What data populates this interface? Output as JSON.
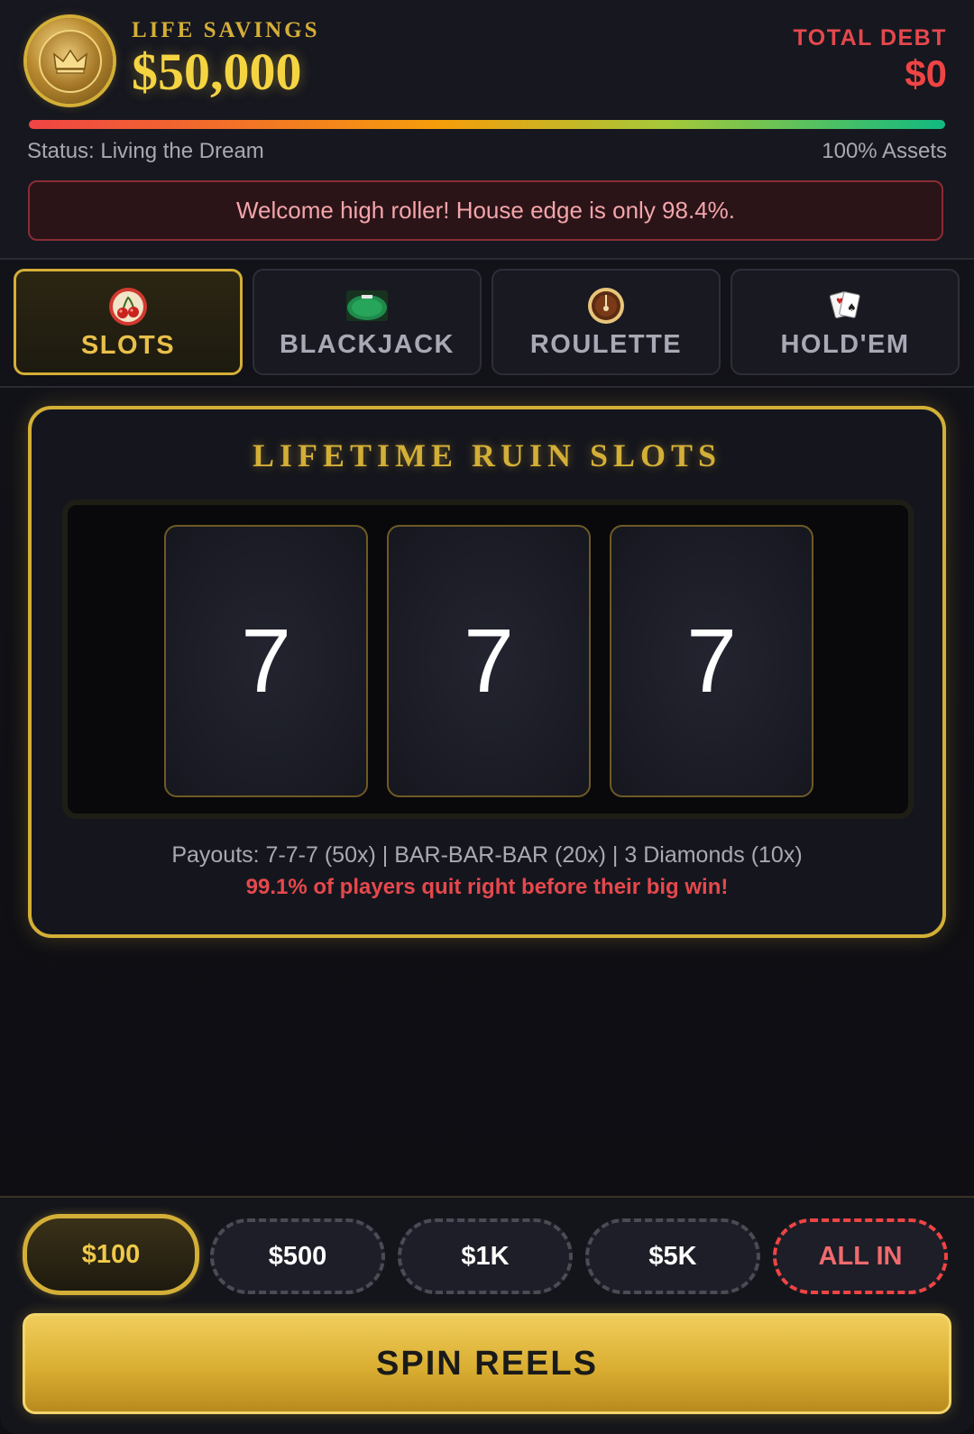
{
  "header": {
    "savings_label": "LIFE SAVINGS",
    "savings_value": "$50,000",
    "debt_label": "TOTAL DEBT",
    "debt_value": "$0",
    "assets_fraction": 1.0,
    "status_text": "Status: Living the Dream",
    "assets_text": "100% Assets",
    "coin_icon": "crown-coin-icon"
  },
  "banner": {
    "message": "Welcome high roller! House edge is only 98.4%."
  },
  "tabs": [
    {
      "label": "SLOTS",
      "icon": "cherry-icon",
      "active": true
    },
    {
      "label": "BLACKJACK",
      "icon": "card-table-icon",
      "active": false
    },
    {
      "label": "ROULETTE",
      "icon": "roulette-wheel-icon",
      "active": false
    },
    {
      "label": "HOLD'EM",
      "icon": "playing-cards-icon",
      "active": false
    }
  ],
  "slots": {
    "title": "LIFETIME RUIN SLOTS",
    "reels": [
      "7",
      "7",
      "7"
    ],
    "payouts": "Payouts: 7-7-7 (50x) | BAR-BAR-BAR (20x) | 3 Diamonds (10x)",
    "warning": "99.1% of players quit right before their big win!"
  },
  "bets": {
    "chips": [
      {
        "label": "$100",
        "selected": true
      },
      {
        "label": "$500",
        "selected": false
      },
      {
        "label": "$1K",
        "selected": false
      },
      {
        "label": "$5K",
        "selected": false
      },
      {
        "label": "ALL IN",
        "selected": false
      }
    ],
    "spin_label": "SPIN REELS"
  },
  "colors": {
    "gold": "#d4af37",
    "danger": "#ef4444",
    "background": "#0f0f14"
  }
}
